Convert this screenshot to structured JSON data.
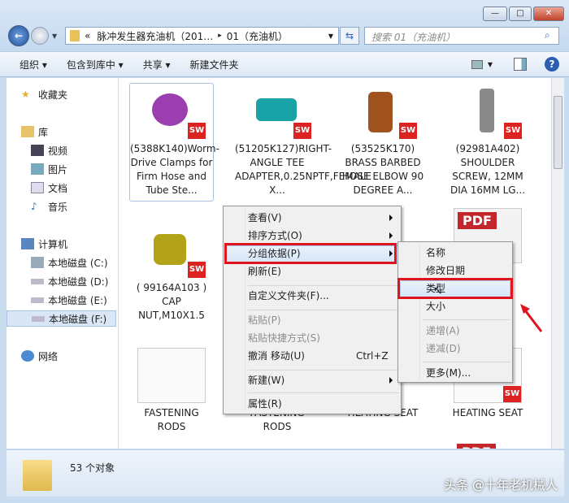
{
  "window": {
    "minimize": "—",
    "maximize": "□",
    "close": "✕"
  },
  "address": {
    "overflow": "«",
    "segment1": "脉冲发生器充油机（201…",
    "separator": "▸",
    "segment2": "01（充油机）"
  },
  "search": {
    "placeholder": "搜索 01（充油机）"
  },
  "toolbar": {
    "organize": "组织 ▾",
    "include_library": "包含到库中 ▾",
    "share": "共享 ▾",
    "new_folder": "新建文件夹",
    "help": "?"
  },
  "sidebar": {
    "favorites": "收藏夹",
    "libraries": "库",
    "lib_items": [
      "视频",
      "图片",
      "文档",
      "音乐"
    ],
    "computer": "计算机",
    "drives": [
      "本地磁盘 (C:)",
      "本地磁盘 (D:)",
      "本地磁盘 (E:)",
      "本地磁盘 (F:)"
    ],
    "network": "网络"
  },
  "files": [
    {
      "name": "(5388K140)Worm-Drive Clamps for Firm Hose and Tube  Ste...",
      "color": "#9b3fb0",
      "type": "sw"
    },
    {
      "name": "(51205K127)RIGHT-ANGLE TEE ADAPTER,0.25NPTF,FEMALE X...",
      "color": "#1aa3a6",
      "type": "sw"
    },
    {
      "name": "(53525K170) BRASS BARBED HOSE ELBOW 90 DEGREE A...",
      "color": "#a0521e",
      "type": "sw"
    },
    {
      "name": "(92981A402) SHOULDER SCREW, 12MM DIA 16MM LG...",
      "color": "#8a8a8a",
      "type": "sw"
    },
    {
      "name": "( 99164A103 ) CAP NUT,M10X1.5",
      "color": "#b3a318",
      "type": "sw"
    },
    {
      "name": "FASTENING RODS",
      "type": "drawing"
    },
    {
      "name": "FASTENING RODS",
      "type": "drawing"
    },
    {
      "name": "HEATING SEAT",
      "type": "drawing"
    },
    {
      "name": "HEATING SEAT",
      "type": "drawing"
    }
  ],
  "pdf_label": "PDF",
  "sw_label": "SW",
  "status": {
    "count": "53 个对象"
  },
  "context_menu": {
    "items": [
      "查看(V)",
      "排序方式(O)",
      "分组依据(P)",
      "刷新(E)",
      "自定义文件夹(F)...",
      "粘贴(P)",
      "粘贴快捷方式(S)",
      "撤消 移动(U)",
      "新建(W)",
      "属性(R)"
    ],
    "undo_shortcut": "Ctrl+Z"
  },
  "submenu": {
    "items": [
      "名称",
      "修改日期",
      "类型",
      "大小",
      "递增(A)",
      "递减(D)",
      "更多(M)..."
    ]
  },
  "watermark": "头条 @十年老机械人"
}
